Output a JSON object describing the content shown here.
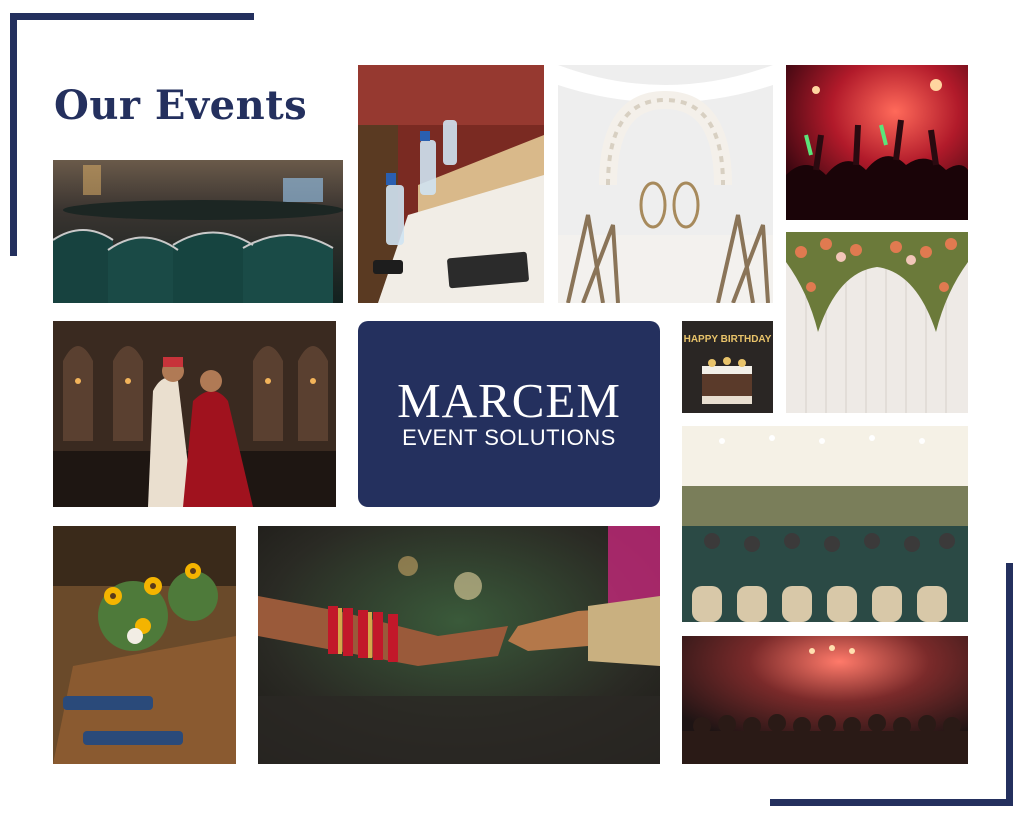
{
  "page": {
    "title": "Our Events"
  },
  "brand": {
    "name": "MARCEM",
    "tagline": "EVENT SOLUTIONS",
    "color": "#24305e"
  },
  "photos": [
    {
      "subject": "conference-hall-chairs"
    },
    {
      "subject": "meeting-table-with-water-bottles"
    },
    {
      "subject": "floral-wedding-arch"
    },
    {
      "subject": "concert-crowd"
    },
    {
      "subject": "indian-wedding-couple"
    },
    {
      "subject": "birthday-cake",
      "cake_topper": "HAPPY BIRTHDAY"
    },
    {
      "subject": "floral-backdrop"
    },
    {
      "subject": "banquet-seminar-audience"
    },
    {
      "subject": "table-setting-sunflowers"
    },
    {
      "subject": "wedding-hands-bangles"
    },
    {
      "subject": "auditorium-audience"
    }
  ]
}
